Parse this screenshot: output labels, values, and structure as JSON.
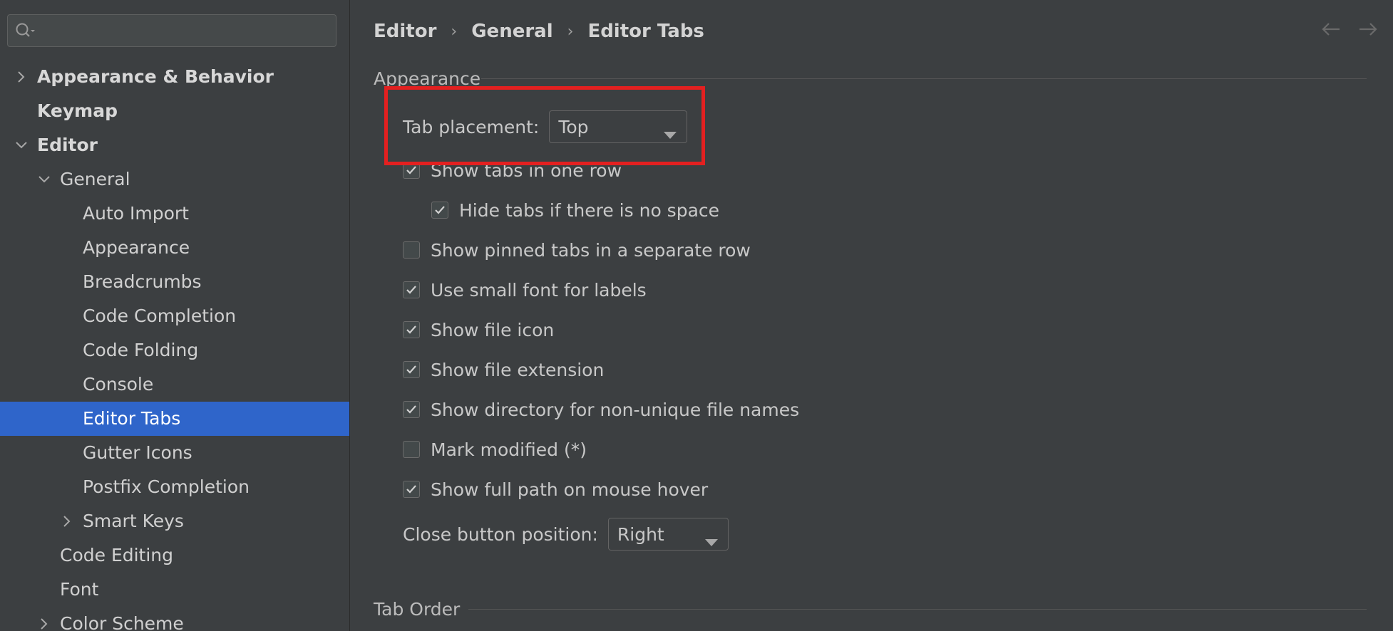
{
  "search": {
    "placeholder": ""
  },
  "sidebar": {
    "items": [
      {
        "label": "Appearance & Behavior",
        "expanded": false,
        "bold": true
      },
      {
        "label": "Keymap",
        "bold": true
      },
      {
        "label": "Editor",
        "expanded": true,
        "bold": true
      },
      {
        "label": "General",
        "expanded": true
      },
      {
        "label": "Auto Import"
      },
      {
        "label": "Appearance"
      },
      {
        "label": "Breadcrumbs"
      },
      {
        "label": "Code Completion"
      },
      {
        "label": "Code Folding"
      },
      {
        "label": "Console"
      },
      {
        "label": "Editor Tabs",
        "selected": true
      },
      {
        "label": "Gutter Icons"
      },
      {
        "label": "Postfix Completion"
      },
      {
        "label": "Smart Keys",
        "expanded": false
      },
      {
        "label": "Code Editing"
      },
      {
        "label": "Font"
      },
      {
        "label": "Color Scheme",
        "expanded": false
      }
    ]
  },
  "breadcrumb": [
    "Editor",
    "General",
    "Editor Tabs"
  ],
  "icons": {
    "search": "search-icon",
    "back": "arrow-left-icon",
    "forward": "arrow-right-icon",
    "expand": "chevron-right-icon",
    "collapse": "chevron-down-icon",
    "dropdown": "caret-down-icon",
    "check": "check-icon"
  },
  "colors": {
    "background": "#3c3f41",
    "selection": "#2f65ca",
    "highlight_box": "#e32020"
  },
  "appearance": {
    "title": "Appearance",
    "tab_placement": {
      "label": "Tab placement:",
      "value": "Top"
    },
    "options": [
      {
        "label": "Show tabs in one row",
        "checked": true
      },
      {
        "label": "Hide tabs if there is no space",
        "checked": true
      },
      {
        "label": "Show pinned tabs in a separate row",
        "checked": false
      },
      {
        "label": "Use small font for labels",
        "checked": true
      },
      {
        "label": "Show file icon",
        "checked": true
      },
      {
        "label": "Show file extension",
        "checked": true
      },
      {
        "label": "Show directory for non-unique file names",
        "checked": true
      },
      {
        "label": "Mark modified (*)",
        "checked": false
      },
      {
        "label": "Show full path on mouse hover",
        "checked": true
      }
    ],
    "close_button": {
      "label": "Close button position:",
      "value": "Right"
    }
  },
  "tab_order": {
    "title": "Tab Order"
  }
}
